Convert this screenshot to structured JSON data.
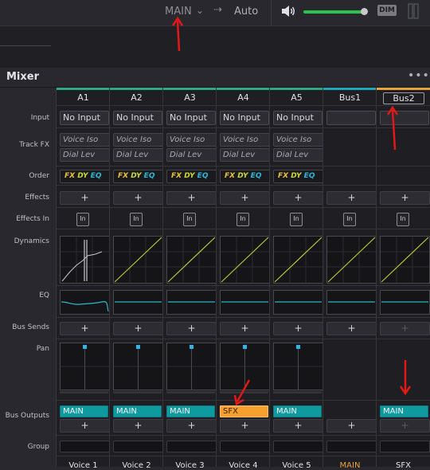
{
  "topbar": {
    "output": "MAIN",
    "automation": "Auto",
    "volume_level": 0.95,
    "dim_label": "DIM"
  },
  "mixer": {
    "title": "Mixer",
    "row_labels": {
      "input": "Input",
      "track_fx": "Track FX",
      "order": "Order",
      "effects": "Effects",
      "effects_in": "Effects In",
      "dynamics": "Dynamics",
      "eq": "EQ",
      "bus_sends": "Bus Sends",
      "pan": "Pan",
      "bus_outputs": "Bus Outputs",
      "group": "Group"
    },
    "order_tokens": {
      "fx": "FX",
      "dy": "DY",
      "eq": "EQ"
    },
    "effects_in_label": "In",
    "plus": "+",
    "colors": {
      "audio_strip": "#2ea882",
      "bus1_strip": "#1ea7b8",
      "bus2_strip": "#e8a23a",
      "main_output": "#0f9aa0",
      "sfx_output": "#f6a030",
      "order_fx": "#e8c038",
      "order_dy": "#c8d838",
      "order_eq": "#2ab8d8",
      "dynamics_line": "#b8c83a",
      "eq_line": "#2cb8c8",
      "pan_marker": "#2fb4e8",
      "annotation_arrow": "#e01818"
    },
    "strips": [
      {
        "name": "A1",
        "input": "No Input",
        "track_fx": [
          "Voice Iso",
          "Dial Lev"
        ],
        "has_order": true,
        "output": "MAIN",
        "track_name": "Voice 1"
      },
      {
        "name": "A2",
        "input": "No Input",
        "track_fx": [
          "Voice Iso",
          "Dial Lev"
        ],
        "has_order": true,
        "output": "MAIN",
        "track_name": "Voice 2"
      },
      {
        "name": "A3",
        "input": "No Input",
        "track_fx": [
          "Voice Iso",
          "Dial Lev"
        ],
        "has_order": true,
        "output": "MAIN",
        "track_name": "Voice 3"
      },
      {
        "name": "A4",
        "input": "No Input",
        "track_fx": [
          "Voice Iso",
          "Dial Lev"
        ],
        "has_order": true,
        "output": "SFX",
        "track_name": "Voice 4"
      },
      {
        "name": "A5",
        "input": "No Input",
        "track_fx": [
          "Voice Iso",
          "Dial Lev"
        ],
        "has_order": true,
        "output": "MAIN",
        "track_name": "Voice 5"
      },
      {
        "name": "Bus1",
        "input": "",
        "track_fx": [],
        "has_order": false,
        "output": "",
        "track_name": "MAIN"
      },
      {
        "name": "Bus2",
        "input": "",
        "track_fx": [],
        "has_order": false,
        "output": "MAIN",
        "track_name": "SFX"
      }
    ]
  }
}
